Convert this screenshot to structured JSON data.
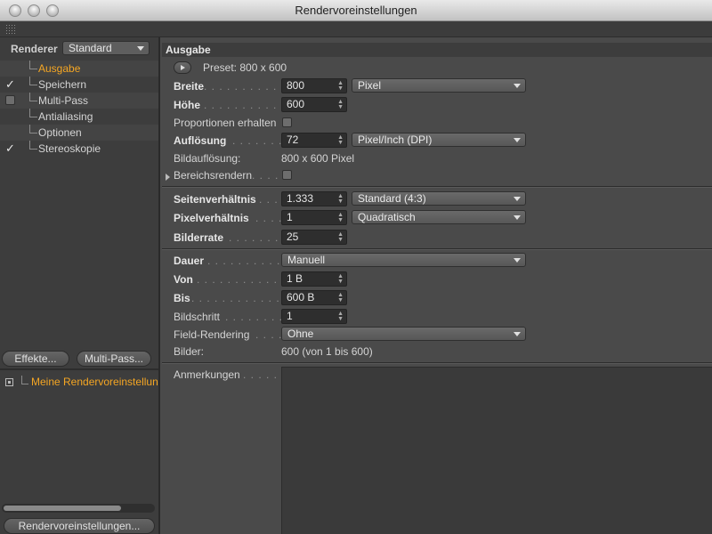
{
  "window": {
    "title": "Rendervoreinstellungen"
  },
  "sidebar": {
    "renderer_label": "Renderer",
    "renderer_value": "Standard",
    "items": [
      {
        "label": "Ausgabe",
        "active": true,
        "check": "none"
      },
      {
        "label": "Speichern",
        "check": "tick"
      },
      {
        "label": "Multi-Pass",
        "check": "box"
      },
      {
        "label": "Antialiasing",
        "check": "none"
      },
      {
        "label": "Optionen",
        "check": "none"
      },
      {
        "label": "Stereoskopie",
        "check": "tick"
      }
    ],
    "effects_button": "Effekte...",
    "multipass_button": "Multi-Pass...",
    "preset_item": "Meine Rendervoreinstellun",
    "settings_button": "Rendervoreinstellungen..."
  },
  "main": {
    "section_title": "Ausgabe",
    "preset": "Preset: 800 x 600",
    "breite_label": "Breite",
    "breite_value": "800",
    "breite_unit": "Pixel",
    "hoehe_label": "Höhe",
    "hoehe_value": "600",
    "proportionen_label": "Proportionen erhalten",
    "aufloesung_label": "Auflösung",
    "aufloesung_value": "72",
    "aufloesung_unit": "Pixel/Inch (DPI)",
    "bildaufloesung_label": "Bildauflösung:",
    "bildaufloesung_value": "800 x 600 Pixel",
    "bereichsrendern_label": "Bereichsrendern",
    "seitenverhaeltnis_label": "Seitenverhältnis",
    "seitenverhaeltnis_value": "1.333",
    "seitenverhaeltnis_preset": "Standard (4:3)",
    "pixelverhaeltnis_label": "Pixelverhältnis",
    "pixelverhaeltnis_value": "1",
    "pixelverhaeltnis_preset": "Quadratisch",
    "bilderrate_label": "Bilderrate",
    "bilderrate_value": "25",
    "dauer_label": "Dauer",
    "dauer_value": "Manuell",
    "von_label": "Von",
    "von_value": "1 B",
    "bis_label": "Bis",
    "bis_value": "600 B",
    "bildschritt_label": "Bildschritt",
    "bildschritt_value": "1",
    "field_label": "Field-Rendering",
    "field_value": "Ohne",
    "bilder_label": "Bilder:",
    "bilder_value": "600 (von 1 bis 600)",
    "anmerkungen_label": "Anmerkungen"
  },
  "colors": {
    "accent": "#f5a623",
    "panel": "#4a4a4a",
    "sidebar": "#3d3d3d"
  }
}
